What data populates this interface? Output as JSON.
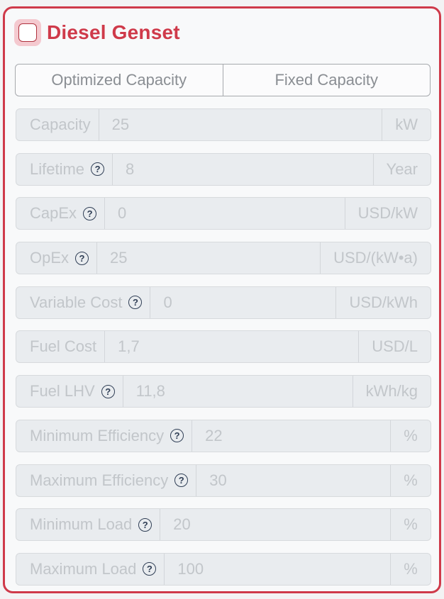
{
  "component": {
    "title": "Diesel Genset",
    "enabled": false,
    "accent_color": "#cf3a4a"
  },
  "capacity_mode": {
    "options": [
      "Optimized Capacity",
      "Fixed Capacity"
    ]
  },
  "fields": [
    {
      "label": "Capacity",
      "help": false,
      "value": "25",
      "unit": "kW"
    },
    {
      "label": "Lifetime",
      "help": true,
      "value": "8",
      "unit": "Year"
    },
    {
      "label": "CapEx",
      "help": true,
      "value": "0",
      "unit": "USD/kW"
    },
    {
      "label": "OpEx",
      "help": true,
      "value": "25",
      "unit": "USD/(kW•a)"
    },
    {
      "label": "Variable Cost",
      "help": true,
      "value": "0",
      "unit": "USD/kWh"
    },
    {
      "label": "Fuel Cost",
      "help": false,
      "value": "1,7",
      "unit": "USD/L"
    },
    {
      "label": "Fuel LHV",
      "help": true,
      "value": "11,8",
      "unit": "kWh/kg"
    },
    {
      "label": "Minimum Efficiency",
      "help": true,
      "value": "22",
      "unit": "%"
    },
    {
      "label": "Maximum Efficiency",
      "help": true,
      "value": "30",
      "unit": "%"
    },
    {
      "label": "Minimum Load",
      "help": true,
      "value": "20",
      "unit": "%"
    },
    {
      "label": "Maximum Load",
      "help": true,
      "value": "100",
      "unit": "%"
    }
  ],
  "icons": {
    "help": "?"
  }
}
